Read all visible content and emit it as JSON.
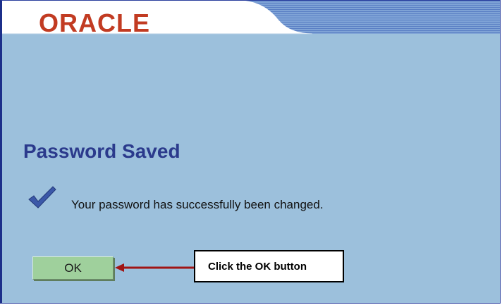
{
  "header": {
    "logo_text": "ORACLE"
  },
  "main": {
    "title": "Password Saved",
    "message": "Your password has successfully been changed.",
    "ok_label": "OK"
  },
  "annotation": {
    "callout_text": "Click the OK button"
  },
  "icons": {
    "success": "checkmark-icon",
    "pointer": "arrow-left-icon"
  },
  "colors": {
    "background": "#9cc0dc",
    "logo": "#c23b22",
    "title": "#2b3a8c",
    "button": "#9fd09c",
    "arrow": "#a01414"
  }
}
